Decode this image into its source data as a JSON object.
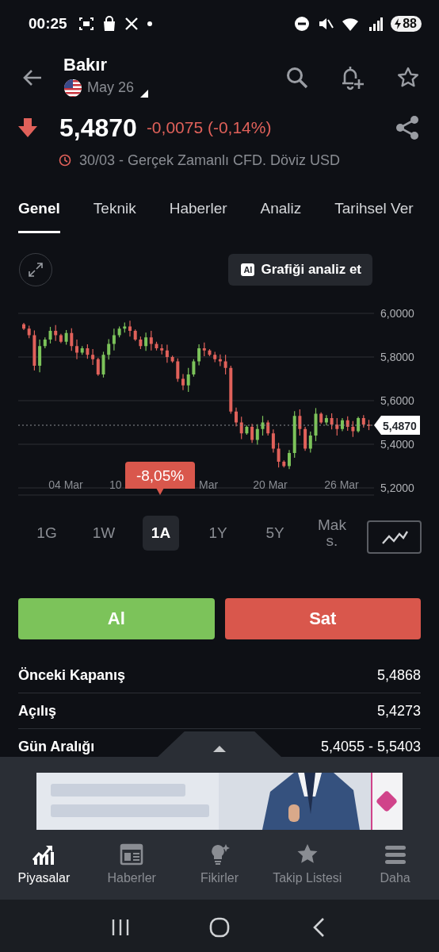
{
  "status_bar": {
    "time": "00:25",
    "battery": "88"
  },
  "header": {
    "title": "Bakır",
    "subtitle": "May 26"
  },
  "quote": {
    "falling": true,
    "price": "5,4870",
    "change": "-0,0075 (-0,14%)",
    "info": "30/03 - Gerçek Zamanlı CFD. Döviz USD"
  },
  "tabs": [
    {
      "label": "Genel",
      "selected": true
    },
    {
      "label": "Teknik",
      "selected": false
    },
    {
      "label": "Haberler",
      "selected": false
    },
    {
      "label": "Analiz",
      "selected": false
    },
    {
      "label": "Tarihsel Ver",
      "selected": false
    }
  ],
  "chart": {
    "ai_badge": "AI",
    "analyze_button": "Grafiği analiz et",
    "y_labels": [
      "6,0000",
      "5,8000",
      "5,6000",
      "5,4000",
      "5,2000"
    ],
    "x_labels": [
      "04 Mar",
      "10",
      "Mar",
      "20 Mar",
      "26 Mar"
    ],
    "last_price": "5,4870",
    "change_tooltip": "-8,05%"
  },
  "periods": [
    {
      "label": "1G",
      "selected": false
    },
    {
      "label": "1W",
      "selected": false
    },
    {
      "label": "1A",
      "selected": true
    },
    {
      "label": "1Y",
      "selected": false
    },
    {
      "label": "5Y",
      "selected": false
    },
    {
      "label": "Mak s.",
      "selected": false
    }
  ],
  "trade_buttons": [
    {
      "label": "Al",
      "kind": "buy"
    },
    {
      "label": "Sat",
      "kind": "sell"
    }
  ],
  "stats": [
    {
      "label": "Önceki Kapanış",
      "value": "5,4868"
    },
    {
      "label": "Açılış",
      "value": "5,4273"
    },
    {
      "label": "Gün Aralığı",
      "value": "5,4055 - 5,5403"
    }
  ],
  "bottom_nav": [
    {
      "label": "Piyasalar",
      "selected": true
    },
    {
      "label": "Haberler",
      "selected": false
    },
    {
      "label": "Fikirler",
      "selected": false
    },
    {
      "label": "Takip Listesi",
      "selected": false
    },
    {
      "label": "Daha",
      "selected": false
    }
  ]
}
